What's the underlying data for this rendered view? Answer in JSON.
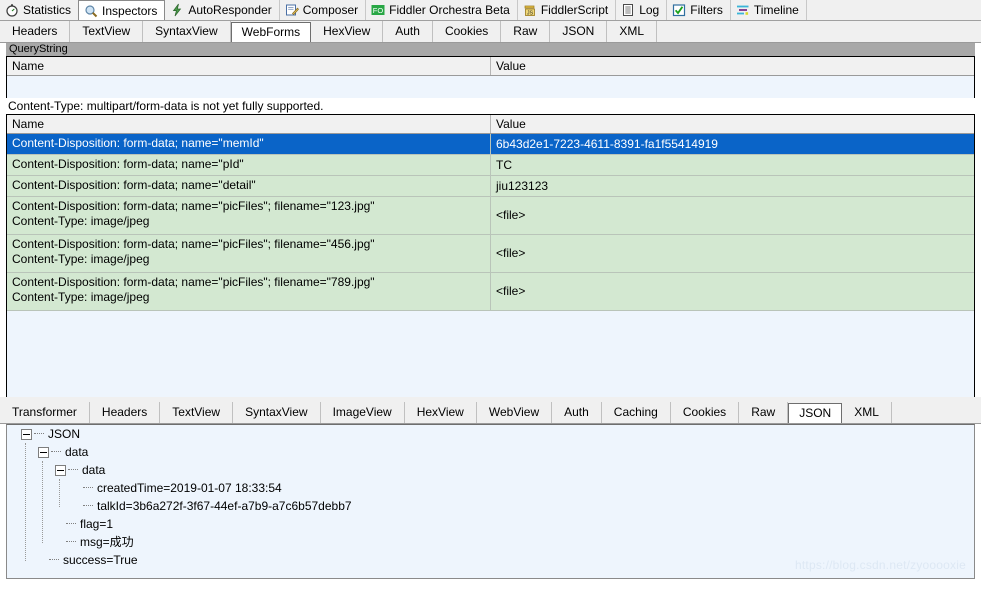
{
  "main_tabs": [
    {
      "label": "Statistics",
      "icon": "stopwatch-icon",
      "active": false
    },
    {
      "label": "Inspectors",
      "icon": "magnifier-icon",
      "active": true
    },
    {
      "label": "AutoResponder",
      "icon": "lightning-icon",
      "active": false
    },
    {
      "label": "Composer",
      "icon": "compose-pencil-icon",
      "active": false
    },
    {
      "label": "Fiddler Orchestra Beta",
      "icon": "fo-badge-icon",
      "active": false
    },
    {
      "label": "FiddlerScript",
      "icon": "script-js-icon",
      "active": false
    },
    {
      "label": "Log",
      "icon": "log-list-icon",
      "active": false
    },
    {
      "label": "Filters",
      "icon": "checkbox-checked-icon",
      "active": false
    },
    {
      "label": "Timeline",
      "icon": "timeline-icon",
      "active": false
    }
  ],
  "request_tabs": [
    {
      "label": "Headers",
      "selected": false
    },
    {
      "label": "TextView",
      "selected": false
    },
    {
      "label": "SyntaxView",
      "selected": false
    },
    {
      "label": "WebForms",
      "selected": true
    },
    {
      "label": "HexView",
      "selected": false
    },
    {
      "label": "Auth",
      "selected": false
    },
    {
      "label": "Cookies",
      "selected": false
    },
    {
      "label": "Raw",
      "selected": false
    },
    {
      "label": "JSON",
      "selected": false
    },
    {
      "label": "XML",
      "selected": false
    }
  ],
  "response_tabs": [
    {
      "label": "Transformer",
      "selected": false
    },
    {
      "label": "Headers",
      "selected": false
    },
    {
      "label": "TextView",
      "selected": false
    },
    {
      "label": "SyntaxView",
      "selected": false
    },
    {
      "label": "ImageView",
      "selected": false
    },
    {
      "label": "HexView",
      "selected": false
    },
    {
      "label": "WebView",
      "selected": false
    },
    {
      "label": "Auth",
      "selected": false
    },
    {
      "label": "Caching",
      "selected": false
    },
    {
      "label": "Cookies",
      "selected": false
    },
    {
      "label": "Raw",
      "selected": false
    },
    {
      "label": "JSON",
      "selected": true
    },
    {
      "label": "XML",
      "selected": false
    }
  ],
  "querystring": {
    "caption": "QueryString",
    "columns": {
      "name": "Name",
      "value": "Value"
    },
    "rows": []
  },
  "body_note": "Content-Type: multipart/form-data is not yet fully supported.",
  "body_grid": {
    "columns": {
      "name": "Name",
      "value": "Value"
    },
    "rows": [
      {
        "name": "Content-Disposition: form-data; name=\"memId\"",
        "value": "6b43d2e1-7223-4611-8391-fa1f55414919",
        "selected": true
      },
      {
        "name": "Content-Disposition: form-data; name=\"pId\"",
        "value": "TC",
        "selected": false
      },
      {
        "name": "Content-Disposition: form-data; name=\"detail\"",
        "value": "jiu123123",
        "selected": false
      },
      {
        "name": "Content-Disposition: form-data; name=\"picFiles\"; filename=\"123.jpg\"\nContent-Type: image/jpeg",
        "value": "<file>",
        "selected": false
      },
      {
        "name": "Content-Disposition: form-data; name=\"picFiles\"; filename=\"456.jpg\"\nContent-Type: image/jpeg",
        "value": "<file>",
        "selected": false
      },
      {
        "name": "Content-Disposition: form-data; name=\"picFiles\"; filename=\"789.jpg\"\nContent-Type: image/jpeg",
        "value": "<file>",
        "selected": false
      }
    ]
  },
  "json_tree": {
    "nodes": [
      {
        "depth": 0,
        "expander": true,
        "label": "JSON"
      },
      {
        "depth": 1,
        "expander": true,
        "label": "data"
      },
      {
        "depth": 2,
        "expander": true,
        "label": "data"
      },
      {
        "depth": 3,
        "expander": false,
        "label": "createdTime=2019-01-07 18:33:54"
      },
      {
        "depth": 3,
        "expander": false,
        "label": "talkId=3b6a272f-3f67-44ef-a7b9-a7c6b57debb7"
      },
      {
        "depth": 2,
        "expander": false,
        "label": "flag=1"
      },
      {
        "depth": 2,
        "expander": false,
        "label": "msg=成功"
      },
      {
        "depth": 1,
        "expander": false,
        "label": "success=True"
      }
    ]
  },
  "watermark": "https://blog.csdn.net/zyooooxie",
  "colors": {
    "selected_row": "#0a64c8",
    "data_row": "#d3e8d1",
    "pane_background": "#eef5fd",
    "caption_bar": "#a8a8a8"
  }
}
